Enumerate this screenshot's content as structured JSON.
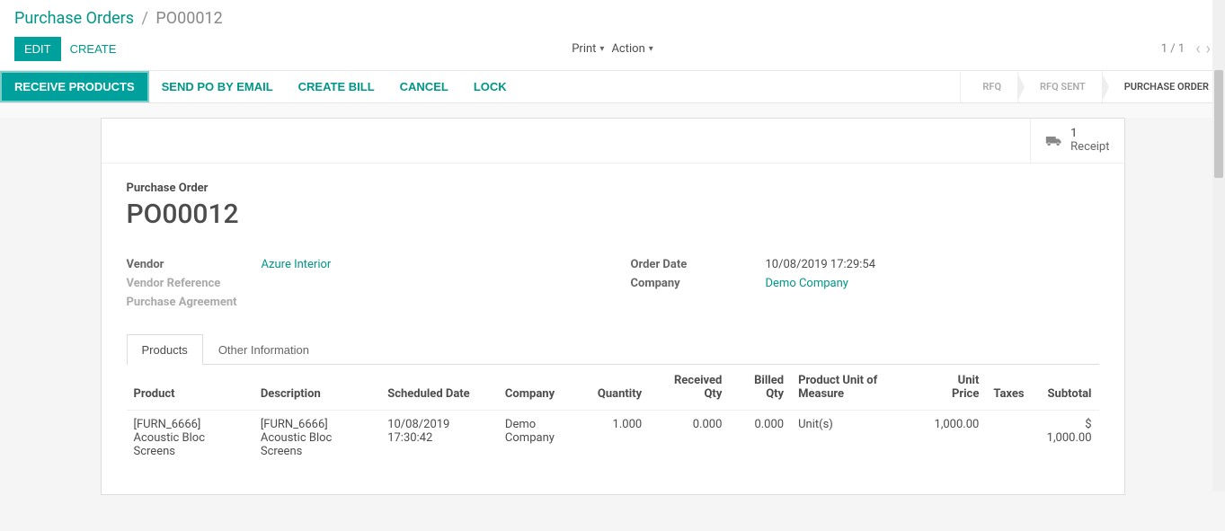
{
  "breadcrumb": {
    "parent": "Purchase Orders",
    "sep": "/",
    "current": "PO00012"
  },
  "toolbar": {
    "edit": "Edit",
    "create": "Create",
    "print": "Print",
    "action": "Action",
    "pager": "1 / 1"
  },
  "actions": {
    "receive": "Receive Products",
    "send_po": "Send PO by Email",
    "create_bill": "Create Bill",
    "cancel": "Cancel",
    "lock": "Lock"
  },
  "status": {
    "rfq": "RFQ",
    "rfq_sent": "RFQ Sent",
    "po": "Purchase Order"
  },
  "stat": {
    "count": "1",
    "label": "Receipt"
  },
  "header": {
    "label": "Purchase Order",
    "name": "PO00012"
  },
  "left": {
    "vendor_label": "Vendor",
    "vendor": "Azure Interior",
    "vendor_ref_label": "Vendor Reference",
    "purchase_agr_label": "Purchase Agreement"
  },
  "right": {
    "order_date_label": "Order Date",
    "order_date": "10/08/2019 17:29:54",
    "company_label": "Company",
    "company": "Demo Company"
  },
  "tabs": {
    "products": "Products",
    "other": "Other Information"
  },
  "table": {
    "headers": {
      "product": "Product",
      "description": "Description",
      "scheduled": "Scheduled Date",
      "company": "Company",
      "quantity": "Quantity",
      "received": "Received Qty",
      "billed": "Billed Qty",
      "uom": "Product Unit of Measure",
      "unit_price": "Unit Price",
      "taxes": "Taxes",
      "subtotal": "Subtotal"
    },
    "rows": [
      {
        "product": "[FURN_6666] Acoustic Bloc Screens",
        "description": "[FURN_6666] Acoustic Bloc Screens",
        "scheduled": "10/08/2019 17:30:42",
        "company": "Demo Company",
        "quantity": "1.000",
        "received": "0.000",
        "billed": "0.000",
        "uom": "Unit(s)",
        "unit_price": "1,000.00",
        "taxes": "",
        "subtotal": "$ 1,000.00"
      }
    ]
  }
}
